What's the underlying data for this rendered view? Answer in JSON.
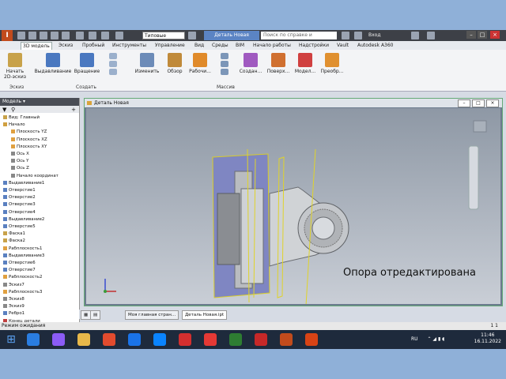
{
  "app": {
    "combo_value": "Типовые",
    "doc_title": "Деталь Новая",
    "search_placeholder": "Поиск по справке и командам",
    "login": "Вход",
    "window_buttons": [
      "–",
      "□",
      "×"
    ]
  },
  "ribbon": {
    "tabs": [
      "3D модель",
      "Эскиз",
      "Пробный",
      "Инструменты",
      "Управление",
      "Вид",
      "Среды",
      "BIM",
      "Начало работы",
      "Надстройки",
      "Vault",
      "Autodesk A360"
    ],
    "active_tab": "3D модель",
    "buttons": [
      {
        "label": "Начать 2D-эскиз",
        "color": "#c8a24a"
      },
      {
        "label": "Выдавливание",
        "color": "#4a78c0"
      },
      {
        "label": "Вращение",
        "color": "#4a78c0"
      },
      {
        "label": "Изменить",
        "color": "#6c8bb8"
      },
      {
        "label": "Обзор",
        "color": "#c08a3a"
      },
      {
        "label": "Рабочи...",
        "color": "#e08a2a"
      },
      {
        "label": "Создан...",
        "color": "#a05ac0"
      },
      {
        "label": "Поверх...",
        "color": "#d07030"
      },
      {
        "label": "Модел...",
        "color": "#d04040"
      },
      {
        "label": "Преобр...",
        "color": "#e09030"
      }
    ],
    "groups": [
      "Эскиз",
      "Создать",
      "Массив"
    ]
  },
  "browser": {
    "title": "Модель ▾",
    "items": [
      {
        "label": "Вид: Главный",
        "indent": 0,
        "color": "#c8a24a"
      },
      {
        "label": "Начало",
        "indent": 0,
        "color": "#d0a040"
      },
      {
        "label": "Плоскость YZ",
        "indent": 2,
        "color": "#e0a040"
      },
      {
        "label": "Плоскость XZ",
        "indent": 2,
        "color": "#e0a040"
      },
      {
        "label": "Плоскость XY",
        "indent": 2,
        "color": "#e0a040"
      },
      {
        "label": "Ось X",
        "indent": 2,
        "color": "#888888"
      },
      {
        "label": "Ось Y",
        "indent": 2,
        "color": "#888888"
      },
      {
        "label": "Ось Z",
        "indent": 2,
        "color": "#888888"
      },
      {
        "label": "Начало координат",
        "indent": 2,
        "color": "#888888"
      },
      {
        "label": "Выдавливание1",
        "indent": 0,
        "color": "#5a80c0"
      },
      {
        "label": "Отверстие1",
        "indent": 0,
        "color": "#5a80c0"
      },
      {
        "label": "Отверстие2",
        "indent": 0,
        "color": "#5a80c0"
      },
      {
        "label": "Отверстие3",
        "indent": 0,
        "color": "#5a80c0"
      },
      {
        "label": "Отверстие4",
        "indent": 0,
        "color": "#5a80c0"
      },
      {
        "label": "Выдавливание2",
        "indent": 0,
        "color": "#5a80c0"
      },
      {
        "label": "Отверстие5",
        "indent": 0,
        "color": "#5a80c0"
      },
      {
        "label": "Фаска1",
        "indent": 0,
        "color": "#c8a24a"
      },
      {
        "label": "Фаска2",
        "indent": 0,
        "color": "#c8a24a"
      },
      {
        "label": "Рабплоскость1",
        "indent": 0,
        "color": "#e0a040"
      },
      {
        "label": "Выдавливание3",
        "indent": 0,
        "color": "#5a80c0"
      },
      {
        "label": "Отверстие6",
        "indent": 0,
        "color": "#5a80c0"
      },
      {
        "label": "Отверстие7",
        "indent": 0,
        "color": "#5a80c0"
      },
      {
        "label": "Рабплоскость2",
        "indent": 0,
        "color": "#e0a040"
      },
      {
        "label": "Эскиз7",
        "indent": 0,
        "color": "#888888"
      },
      {
        "label": "Рабплоскость3",
        "indent": 0,
        "color": "#e0a040"
      },
      {
        "label": "Эскиз8",
        "indent": 0,
        "color": "#888888"
      },
      {
        "label": "Эскиз9",
        "indent": 0,
        "color": "#888888"
      },
      {
        "label": "Ребро1",
        "indent": 0,
        "color": "#5a80c0"
      },
      {
        "label": "Конец детали",
        "indent": 0,
        "color": "#c04040"
      }
    ]
  },
  "graphics": {
    "window_title": "Деталь Новая",
    "annotation": "Опора отредактирована"
  },
  "doc_tabs": [
    "Моя главная стран...",
    "Деталь Новая.ipt"
  ],
  "status": {
    "text": "Режим ожидания",
    "right": "1    1"
  },
  "taskbar": {
    "tray_lang": "RU",
    "time": "11:46",
    "date": "16.11.2022",
    "apps": [
      "#2a7de1",
      "#8b5cf6",
      "#e8b84a",
      "#e24b2e",
      "#1a73e8",
      "#0a84ff",
      "#d32f2f",
      "#e53935",
      "#2e7d32",
      "#c62828",
      "#c24b1c",
      "#d84315"
    ]
  }
}
